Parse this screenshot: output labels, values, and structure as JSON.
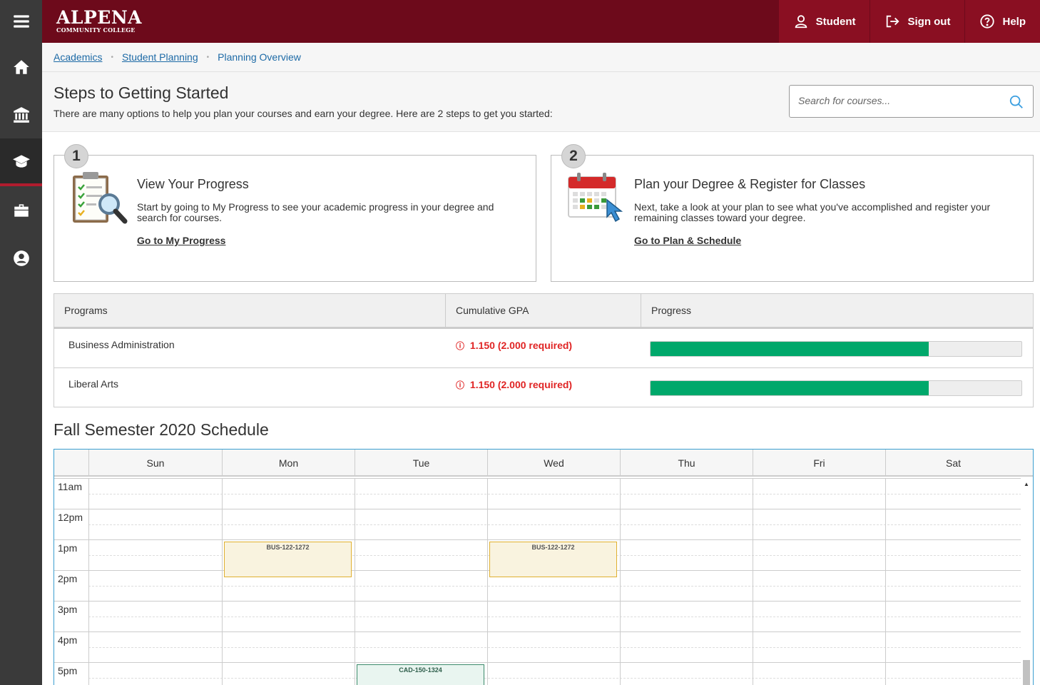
{
  "app": {
    "logo_main": "ALPENA",
    "logo_sub": "COMMUNITY COLLEGE"
  },
  "header": {
    "student_label": "Student",
    "signout_label": "Sign out",
    "help_label": "Help"
  },
  "breadcrumb": {
    "items": [
      "Academics",
      "Student Planning",
      "Planning Overview"
    ]
  },
  "intro": {
    "title": "Steps to Getting Started",
    "subtitle": "There are many options to help you plan your courses and earn your degree. Here are 2 steps to get you started:",
    "search_placeholder": "Search for courses..."
  },
  "steps": [
    {
      "number": "1",
      "title": "View Your Progress",
      "text": "Start by going to My Progress to see your academic progress in your degree and search for courses.",
      "link": "Go to My Progress"
    },
    {
      "number": "2",
      "title": "Plan your Degree & Register for Classes",
      "text": "Next, take a look at your plan to see what you've accomplished and register your remaining classes toward your degree.",
      "link": "Go to Plan & Schedule"
    }
  ],
  "programs": {
    "headers": [
      "Programs",
      "Cumulative GPA",
      "Progress"
    ],
    "rows": [
      {
        "name": "Business Administration",
        "gpa": "1.150 (2.000 required)",
        "progress": 0.75
      },
      {
        "name": "Liberal Arts",
        "gpa": "1.150 (2.000 required)",
        "progress": 0.75
      }
    ]
  },
  "schedule": {
    "title": "Fall Semester 2020 Schedule",
    "days": [
      "Sun",
      "Mon",
      "Tue",
      "Wed",
      "Thu",
      "Fri",
      "Sat"
    ],
    "hours": [
      "11am",
      "12pm",
      "1pm",
      "2pm",
      "3pm",
      "4pm",
      "5pm"
    ],
    "events": [
      {
        "code": "BUS-122-1272",
        "day": "Mon",
        "start": "1pm",
        "type": "bus"
      },
      {
        "code": "BUS-122-1272",
        "day": "Wed",
        "start": "1pm",
        "type": "bus"
      },
      {
        "code": "CAD-150-1324",
        "day": "Tue",
        "start": "5pm",
        "type": "cad"
      }
    ]
  },
  "colors": {
    "header_bg": "#6d0a1b",
    "header_btn_bg": "#8a0f22",
    "progress_fill": "#00a86b",
    "gpa_warning": "#e02424",
    "link": "#1d6aa6"
  },
  "icons": [
    "menu-icon",
    "home-icon",
    "bank-icon",
    "graduation-cap-icon",
    "briefcase-icon",
    "user-circle-icon",
    "user-icon",
    "sign-out-icon",
    "help-icon",
    "search-icon",
    "warning-icon"
  ]
}
